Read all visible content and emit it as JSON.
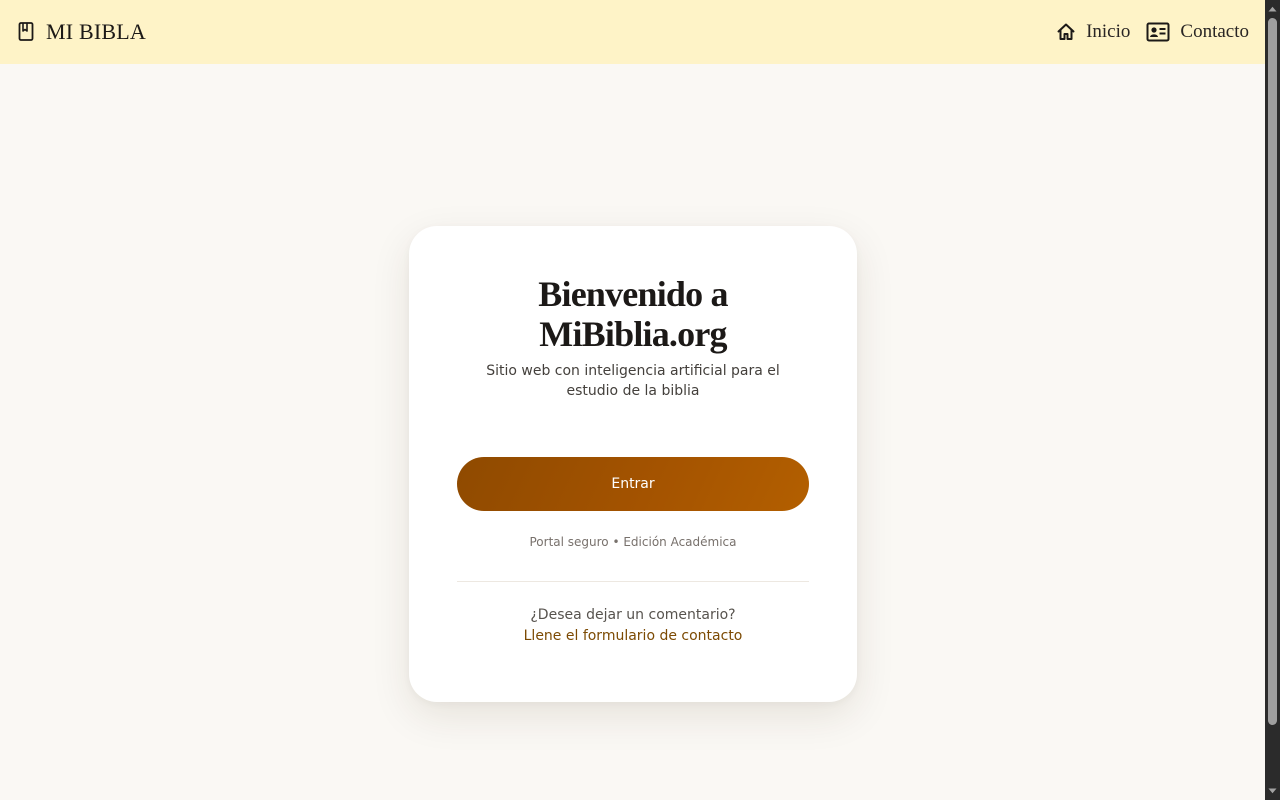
{
  "header": {
    "brand": "MI BIBLA",
    "brand_icon": "bookmark-book-icon",
    "nav": [
      {
        "label": "Inicio",
        "icon": "home-icon"
      },
      {
        "label": "Contacto",
        "icon": "contact-card-icon"
      }
    ],
    "background_color": "#fef3c7"
  },
  "card": {
    "title_line1": "Bienvenido a",
    "title_line2": "MiBiblia.org",
    "subtitle": "Sitio web con inteligencia artificial para el estudio de la biblia",
    "enter_label": "Entrar",
    "note": "Portal seguro • Edición Académica",
    "comment_question": "¿Desea dejar un comentario?",
    "contact_link": "Llene el formulario de contacto"
  },
  "colors": {
    "accent": "#a45300",
    "page_background": "#faf8f4",
    "link": "#7c4a03"
  }
}
